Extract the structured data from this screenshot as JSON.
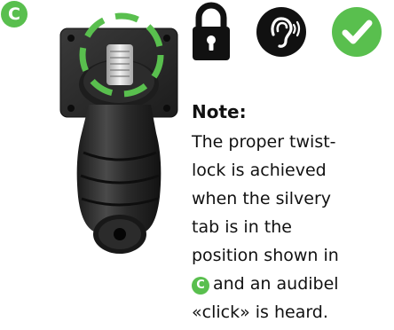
{
  "step": {
    "label": "C",
    "color": "#59bf4e"
  },
  "icons": {
    "lock": "lock-icon",
    "ear": "ear-sound-icon",
    "check": "checkmark-icon"
  },
  "colors": {
    "green": "#59bf4e",
    "icon_black": "#111111",
    "connector_dark": "#2b2b2b"
  },
  "note": {
    "title": "Note:",
    "line1": "The proper twist-",
    "line2": "lock is achieved",
    "line3": "when the silvery",
    "line4": "tab is in the",
    "line5": "position shown in",
    "badge": "C",
    "line6_rest": "and an audibel",
    "line7": "«click» is heard."
  }
}
